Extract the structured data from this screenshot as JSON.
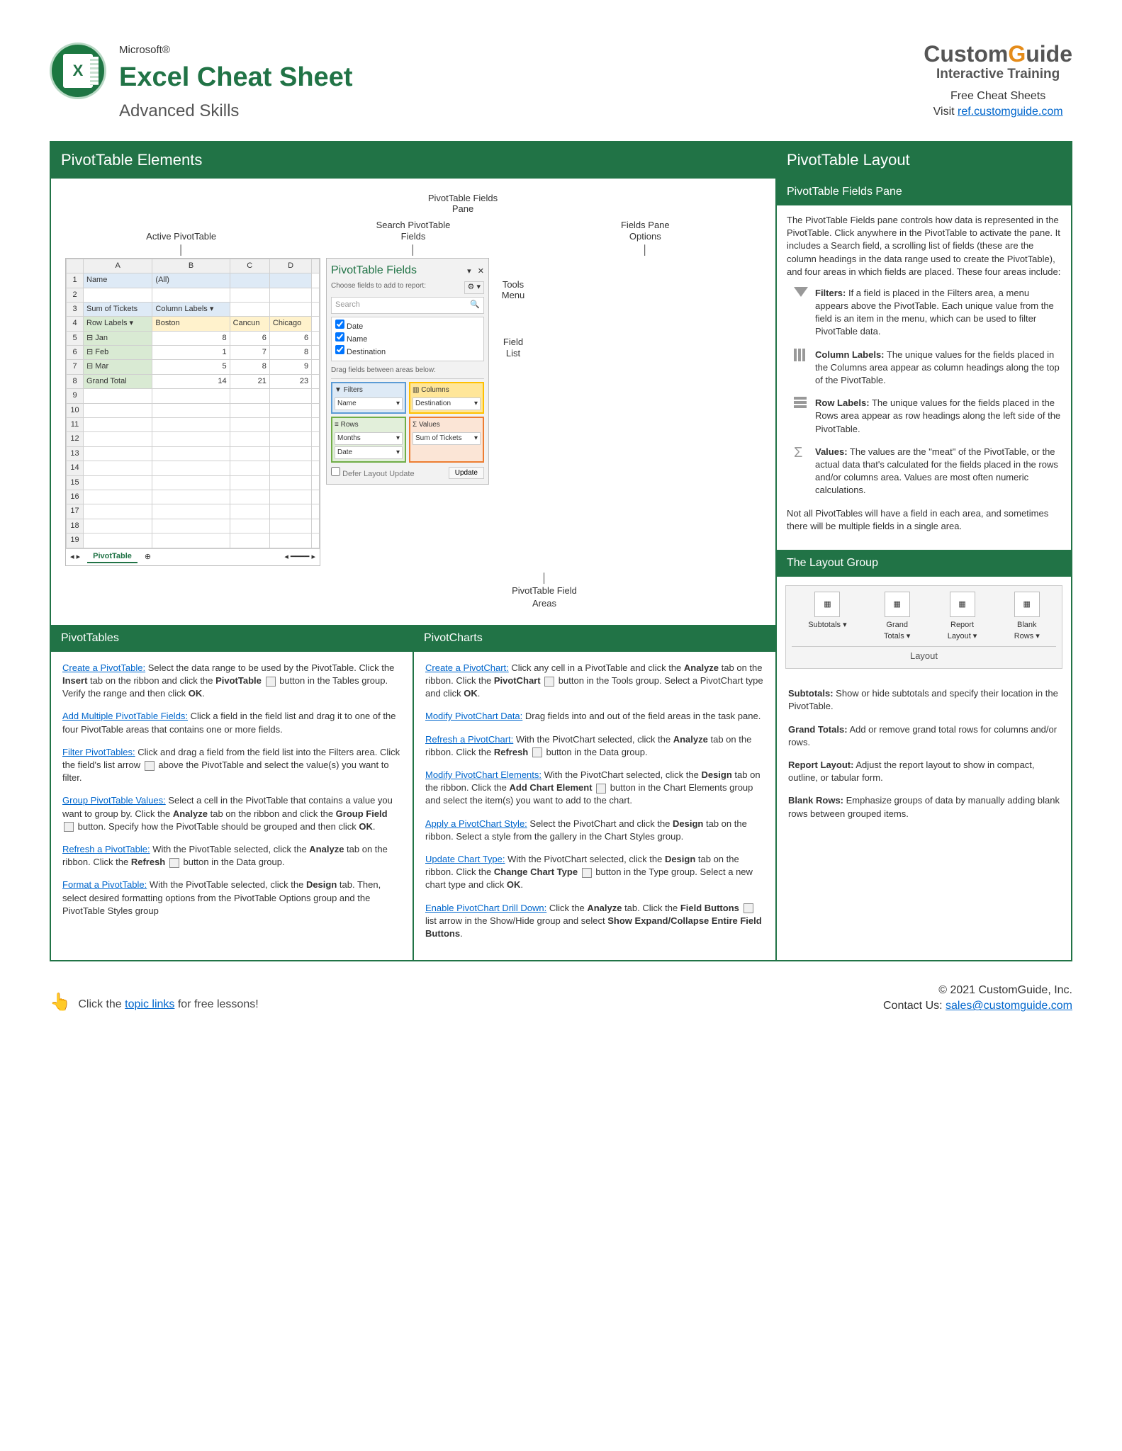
{
  "header": {
    "microsoft": "Microsoft®",
    "title": "Excel Cheat Sheet",
    "subtitle": "Advanced Skills",
    "logoLetter": "X",
    "cg1": "Custom",
    "cg2": "G",
    "cg3": "uide",
    "cgSub": "Interactive Training",
    "freeLine": "Free Cheat Sheets",
    "visit": "Visit ",
    "visitLink": "ref.customguide.com"
  },
  "sections": {
    "ptElements": "PivotTable Elements",
    "ptLayout": "PivotTable Layout",
    "ptFieldsPane": "PivotTable Fields Pane",
    "pivotTables": "PivotTables",
    "pivotCharts": "PivotCharts",
    "layoutGroup": "The Layout Group"
  },
  "callouts": {
    "fieldsPane": "PivotTable Fields\nPane",
    "activePT": "Active PivotTable",
    "searchFields": "Search PivotTable\nFields",
    "paneOptions": "Fields Pane\nOptions",
    "toolsMenu": "Tools\nMenu",
    "fieldList": "Field\nList",
    "fieldAreas": "PivotTable Field\nAreas"
  },
  "sheet": {
    "cols": [
      "A",
      "B",
      "C",
      "D"
    ],
    "rows": [
      [
        "1",
        "Name",
        "(All)",
        "",
        ""
      ],
      [
        "2",
        "",
        "",
        "",
        ""
      ],
      [
        "3",
        "Sum of Tickets",
        "Column Labels ▾",
        "",
        ""
      ],
      [
        "4",
        "Row Labels ▾",
        "Boston",
        "Cancun",
        "Chicago"
      ],
      [
        "5",
        "⊟ Jan",
        "8",
        "6",
        "6"
      ],
      [
        "6",
        "⊟ Feb",
        "1",
        "7",
        "8"
      ],
      [
        "7",
        "⊟ Mar",
        "5",
        "8",
        "9"
      ],
      [
        "8",
        "Grand Total",
        "14",
        "21",
        "23"
      ],
      [
        "9",
        "",
        "",
        "",
        ""
      ],
      [
        "10",
        "",
        "",
        "",
        ""
      ],
      [
        "11",
        "",
        "",
        "",
        ""
      ],
      [
        "12",
        "",
        "",
        "",
        ""
      ],
      [
        "13",
        "",
        "",
        "",
        ""
      ],
      [
        "14",
        "",
        "",
        "",
        ""
      ],
      [
        "15",
        "",
        "",
        "",
        ""
      ],
      [
        "16",
        "",
        "",
        "",
        ""
      ],
      [
        "17",
        "",
        "",
        "",
        ""
      ],
      [
        "18",
        "",
        "",
        "",
        ""
      ],
      [
        "19",
        "",
        "",
        "",
        ""
      ]
    ],
    "tabName": "PivotTable"
  },
  "fieldsPane": {
    "title": "PivotTable Fields",
    "hint": "Choose fields to add to report:",
    "search": "Search",
    "fields": [
      "Date",
      "Name",
      "Destination"
    ],
    "dragHint": "Drag fields between areas below:",
    "filters": "Filters",
    "filtersItem": "Name",
    "columns": "Columns",
    "columnsItem": "Destination",
    "rowsLbl": "Rows",
    "rowsItems": [
      "Months",
      "Date"
    ],
    "values": "Values",
    "valuesItem": "Sum of Tickets",
    "defer": "Defer Layout Update",
    "update": "Update"
  },
  "fieldsPaneDesc": {
    "intro": "The PivotTable Fields pane controls how data is represented in the PivotTable. Click anywhere in the PivotTable to activate the pane. It includes a Search field, a scrolling list of fields (these are the column headings in the data range used to create the PivotTable), and four areas in which fields are placed. These four areas include:",
    "filters": "If a field is placed in the Filters area, a menu appears above the PivotTable. Each unique value from the field is an item in the menu, which can be used to filter PivotTable data.",
    "filtersLbl": "Filters:",
    "columns": "The unique values for the fields placed in the Columns area appear as column headings along the top of the PivotTable.",
    "columnsLbl": "Column Labels:",
    "rows": "The unique values for the fields placed in the Rows area appear as row headings along the left side of the PivotTable.",
    "rowsLbl": "Row Labels:",
    "values": "The values are the \"meat\" of the PivotTable, or the actual data that's calculated for the fields placed in the rows and/or columns area. Values are most often numeric calculations.",
    "valuesLbl": "Values:",
    "outro": "Not all PivotTables will have a field in each area, and sometimes there will be multiple fields in a single area."
  },
  "layoutGroup": {
    "btns": [
      "Subtotals ▾",
      "Grand\nTotals ▾",
      "Report\nLayout ▾",
      "Blank\nRows ▾"
    ],
    "title": "Layout",
    "items": [
      {
        "t": "Subtotals:",
        "d": "Show or hide subtotals and specify their location in the PivotTable."
      },
      {
        "t": "Grand Totals:",
        "d": "Add or remove grand total rows for columns and/or rows."
      },
      {
        "t": "Report Layout:",
        "d": "Adjust the report layout to show in compact, outline, or tabular form."
      },
      {
        "t": "Blank Rows:",
        "d": "Emphasize groups of data by manually adding blank rows between grouped items."
      }
    ]
  },
  "pivotTables": [
    {
      "link": "Create a PivotTable:",
      "text": "Select the data range to be used by the PivotTable. Click the <b>Insert</b> tab on the ribbon and click the <b>PivotTable</b> <span class='icon-inline'></span> button in the Tables group. Verify the range and then click <b>OK</b>."
    },
    {
      "link": "Add Multiple PivotTable Fields:",
      "text": "Click a field in the field list and drag it to one of the four PivotTable areas that contains one or more fields."
    },
    {
      "link": "Filter PivotTables:",
      "text": "Click and drag a field from the field list into the Filters area. Click the field's list arrow <span class='icon-inline'></span> above the PivotTable and select the value(s) you want to filter."
    },
    {
      "link": "Group PivotTable Values:",
      "text": "Select a cell in the PivotTable that contains a value you want to group by. Click the <b>Analyze</b> tab on the ribbon and click the <b>Group Field</b> <span class='icon-inline'></span> button. Specify how the PivotTable should be grouped and then click <b>OK</b>."
    },
    {
      "link": "Refresh a PivotTable:",
      "text": "With the PivotTable selected, click the <b>Analyze</b> tab on the ribbon. Click the <b>Refresh</b> <span class='icon-inline'></span> button in the Data group."
    },
    {
      "link": "Format a PivotTable:",
      "text": "With the PivotTable selected, click the <b>Design</b> tab. Then, select desired formatting options from the PivotTable Options group and the PivotTable Styles group"
    }
  ],
  "pivotCharts": [
    {
      "link": "Create a PivotChart:",
      "text": "Click any cell in a PivotTable and click the <b>Analyze</b> tab on the ribbon. Click the <b>PivotChart</b> <span class='icon-inline'></span> button in the Tools group. Select a PivotChart type and click <b>OK</b>."
    },
    {
      "link": "Modify PivotChart Data:",
      "text": "Drag fields into and out of the field areas in the task pane."
    },
    {
      "link": "Refresh a PivotChart:",
      "text": "With the PivotChart selected, click the <b>Analyze</b> tab on the ribbon. Click the <b>Refresh</b> <span class='icon-inline'></span> button in the Data group."
    },
    {
      "link": "Modify PivotChart Elements:",
      "text": "With the PivotChart selected, click the <b>Design</b> tab on the ribbon. Click the <b>Add Chart Element</b> <span class='icon-inline'></span> button in the Chart Elements group and select the item(s) you want to add to the chart."
    },
    {
      "link": "Apply a PivotChart Style:",
      "text": "Select the PivotChart and click the <b>Design</b> tab on the ribbon. Select a style from the gallery in the Chart Styles group."
    },
    {
      "link": "Update Chart Type:",
      "text": "With the PivotChart selected, click the <b>Design</b> tab on the ribbon. Click the <b>Change Chart Type</b> <span class='icon-inline'></span> button in the Type group. Select a new chart type and click <b>OK</b>."
    },
    {
      "link": "Enable PivotChart Drill Down:",
      "text": "Click the <b>Analyze</b> tab. Click the <b>Field Buttons</b> <span class='icon-inline'></span> list arrow in the Show/Hide group and select <b>Show Expand/Collapse Entire Field Buttons</b>."
    }
  ],
  "footer": {
    "left": "Click the ",
    "leftLink": "topic links",
    "leftAfter": " for free lessons!",
    "copyright": "© 2021 CustomGuide, Inc.",
    "contact": "Contact Us: ",
    "email": "sales@customguide.com"
  }
}
